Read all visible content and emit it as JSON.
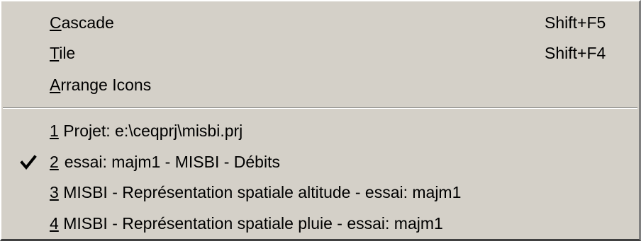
{
  "menu": {
    "cascade": {
      "mnemonic": "C",
      "rest": "ascade",
      "shortcut": "Shift+F5"
    },
    "tile": {
      "mnemonic": "T",
      "rest": "ile",
      "shortcut": "Shift+F4"
    },
    "arrange": {
      "mnemonic": "A",
      "rest": "rrange Icons"
    },
    "windows": [
      {
        "num": "1",
        "title": "Projet: e:\\ceqprj\\misbi.prj",
        "checked": false
      },
      {
        "num": "2",
        "title": "essai: majm1 - MISBI - Débits",
        "checked": true
      },
      {
        "num": "3",
        "title": "MISBI - Représentation spatiale altitude - essai: majm1",
        "checked": false
      },
      {
        "num": "4",
        "title": "MISBI - Représentation spatiale pluie - essai: majm1",
        "checked": false
      }
    ]
  },
  "icons": {
    "check": "checkmark-icon"
  }
}
